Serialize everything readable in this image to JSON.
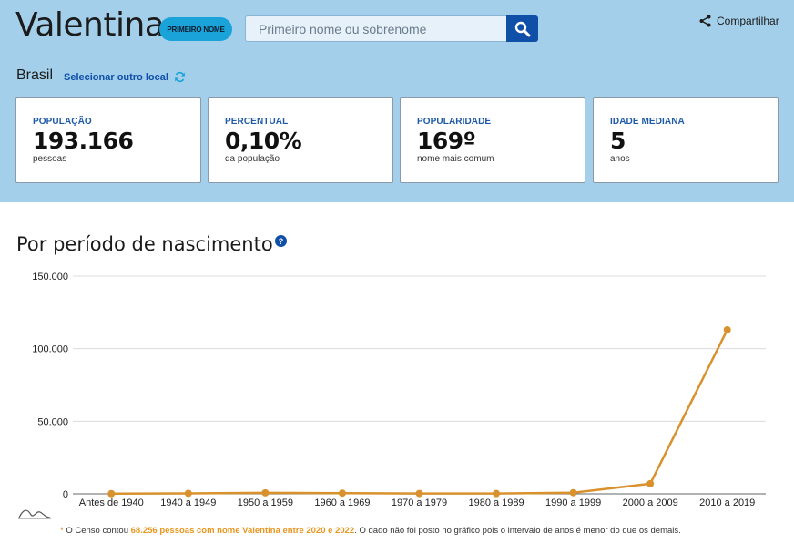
{
  "header": {
    "name": "Valentina",
    "badge": "PRIMEIRO NOME",
    "search_placeholder": "Primeiro nome ou sobrenome",
    "share_label": "Compartilhar",
    "location": "Brasil",
    "change_location": "Selecionar outro local"
  },
  "stats": [
    {
      "label": "POPULAÇÃO",
      "value": "193.166",
      "sub": "pessoas"
    },
    {
      "label": "PERCENTUAL",
      "value": "0,10%",
      "sub": "da população"
    },
    {
      "label": "POPULARIDADE",
      "value": "169º",
      "sub": "nome mais comum"
    },
    {
      "label": "IDADE MEDIANA",
      "value": "5",
      "sub": "anos"
    }
  ],
  "section": {
    "title": "Por período de nascimento",
    "help": "?"
  },
  "footnote": {
    "star": "*",
    "prefix": " O Censo contou ",
    "highlight": "68.256 pessoas com nome Valentina entre 2020 e 2022",
    "suffix": ". O dado não foi posto no gráfico pois o intervalo de anos é menor do que os demais."
  },
  "colors": {
    "hero_bg": "#a3cfea",
    "accent": "#0f4fa8",
    "line": "#d9912e"
  },
  "chart_data": {
    "type": "line",
    "categories": [
      "Antes de 1940",
      "1940 a 1949",
      "1950 a 1959",
      "1960 a 1969",
      "1970 a 1979",
      "1980 a 1989",
      "1990 a 1999",
      "2000 a 2009",
      "2010 a 2019"
    ],
    "series": [
      {
        "values": [
          150,
          350,
          700,
          500,
          250,
          200,
          800,
          7000,
          113000
        ]
      }
    ],
    "yticks": [
      0,
      50000,
      100000,
      150000
    ],
    "ytick_labels": [
      "0",
      "50.000",
      "100.000",
      "150.000"
    ],
    "ylim": [
      0,
      150000
    ],
    "grid": true
  }
}
